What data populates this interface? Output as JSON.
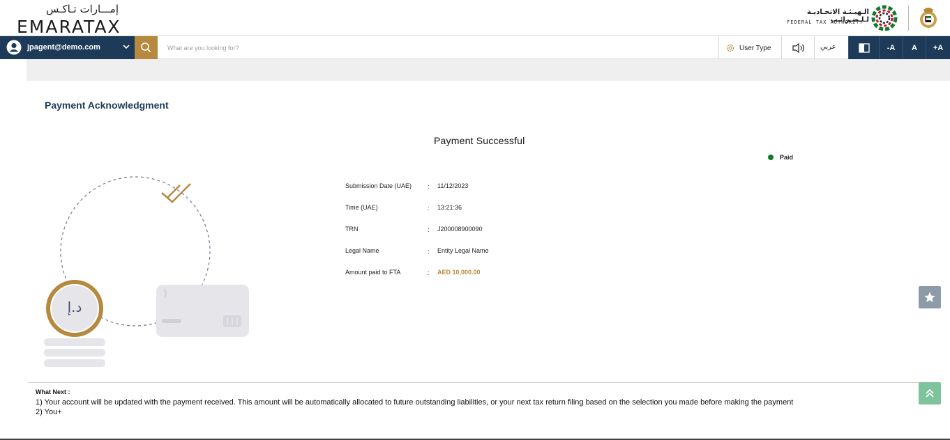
{
  "header": {
    "logo_arabic": "إمـــارات تـاكـس",
    "logo_english": "EMARATAX",
    "fta_arabic": "الـهيـئـة الاتحـاديـة لـلـضـرائـب",
    "fta_english": "FEDERAL TAX AUTHORITY"
  },
  "toolbar": {
    "user_email": "jpagent@demo.com",
    "search_placeholder": "What are you looking for?",
    "user_type_label": "User Type",
    "language_label": "عربي",
    "font_decrease": "-A",
    "font_normal": "A",
    "font_increase": "+A"
  },
  "page": {
    "title": "Payment Acknowledgment",
    "success_title": "Payment Successful",
    "status": {
      "label": "Paid",
      "color": "#127a2e"
    },
    "currency_symbol": "د.إ"
  },
  "details": [
    {
      "label": "Submission Date (UAE)",
      "value": "11/12/2023"
    },
    {
      "label": "Time (UAE)",
      "value": "13:21:36"
    },
    {
      "label": "TRN",
      "value": "J200008900090"
    },
    {
      "label": "Legal Name",
      "value": "Entity Legal Name"
    },
    {
      "label": "Amount paid to FTA",
      "value": "AED 10,000.00"
    }
  ],
  "what_next": {
    "heading": "What Next :",
    "line1": "1) Your account will be updated with the payment received. This amount will be automatically allocated to future outstanding liabilities, or your next tax return filing based on the selection you made before making the payment",
    "line2": "2) You+"
  },
  "colors": {
    "navy": "#1d3a58",
    "gold": "#b68a3e",
    "paid_green": "#127a2e"
  }
}
